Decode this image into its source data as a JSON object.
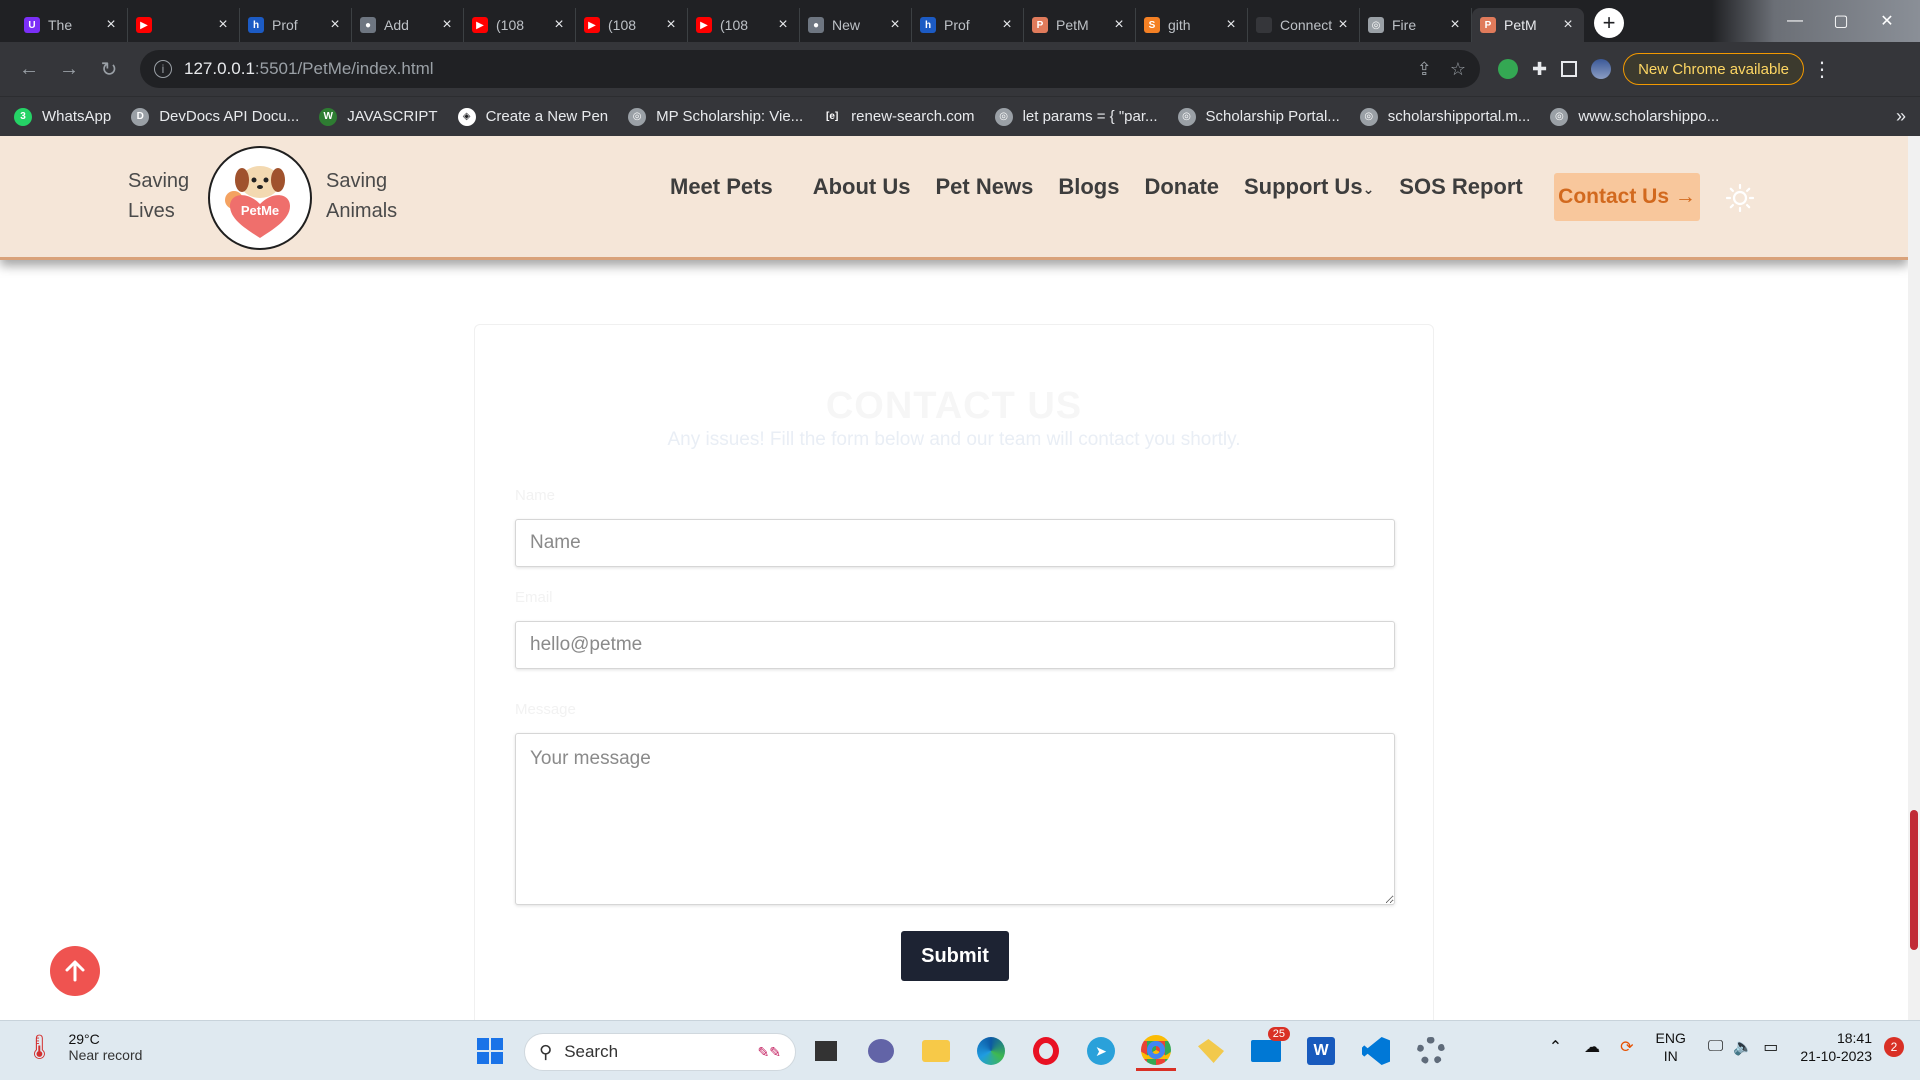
{
  "browser": {
    "tabs": [
      {
        "title": "The",
        "fav_color": "#7b2ff7",
        "fav_glyph": "U"
      },
      {
        "title": "",
        "fav_color": "#ff0000",
        "fav_glyph": "▶"
      },
      {
        "title": "Prof",
        "fav_color": "#1c5bc4",
        "fav_glyph": "h"
      },
      {
        "title": "Add",
        "fav_color": "#6e7681",
        "fav_glyph": "●"
      },
      {
        "title": "(108",
        "fav_color": "#ff0000",
        "fav_glyph": "▶"
      },
      {
        "title": "(108",
        "fav_color": "#ff0000",
        "fav_glyph": "▶"
      },
      {
        "title": "(108",
        "fav_color": "#ff0000",
        "fav_glyph": "▶"
      },
      {
        "title": "New",
        "fav_color": "#6e7681",
        "fav_glyph": "●"
      },
      {
        "title": "Prof",
        "fav_color": "#1c5bc4",
        "fav_glyph": "h"
      },
      {
        "title": "PetM",
        "fav_color": "#e07b5b",
        "fav_glyph": "P"
      },
      {
        "title": "gith",
        "fav_color": "#f48024",
        "fav_glyph": "S"
      },
      {
        "title": "Connect",
        "fav_color": "#35363a",
        "fav_glyph": ""
      },
      {
        "title": "Fire",
        "fav_color": "#9aa0a6",
        "fav_glyph": "◎"
      },
      {
        "title": "PetM",
        "fav_color": "#e07b5b",
        "fav_glyph": "P",
        "active": true
      }
    ],
    "url_host": "127.0.0.1",
    "url_path": ":5501/PetMe/index.html",
    "update_label": "New Chrome available",
    "bookmarks": [
      {
        "label": "WhatsApp",
        "color": "#25d366",
        "glyph": "3"
      },
      {
        "label": "DevDocs API Docu...",
        "color": "#9aa0a6",
        "glyph": "D"
      },
      {
        "label": "JAVASCRIPT",
        "color": "#2e7d32",
        "glyph": "W"
      },
      {
        "label": "Create a New Pen",
        "color": "#ffffff",
        "glyph": "◈"
      },
      {
        "label": "MP Scholarship: Vie...",
        "color": "#9aa0a6",
        "glyph": "◎"
      },
      {
        "label": "renew-search.com",
        "color": "#35363a",
        "glyph": "[e]"
      },
      {
        "label": "let params = { \"par...",
        "color": "#9aa0a6",
        "glyph": "◎"
      },
      {
        "label": "Scholarship Portal...",
        "color": "#9aa0a6",
        "glyph": "◎"
      },
      {
        "label": "scholarshipportal.m...",
        "color": "#9aa0a6",
        "glyph": "◎"
      },
      {
        "label": "www.scholarshippo...",
        "color": "#9aa0a6",
        "glyph": "◎"
      }
    ],
    "bookmarks_more": "»"
  },
  "site": {
    "tagline_left": [
      "Saving",
      "Lives"
    ],
    "tagline_right": [
      "Saving",
      "Animals"
    ],
    "logo_text": "PetMe",
    "nav": [
      "Meet Pets",
      "About Us",
      "Pet News",
      "Blogs",
      "Donate",
      "Support Us",
      "SOS Report"
    ],
    "contact_button": "Contact Us →",
    "accent": "#f8c79c",
    "nav_bg": "#f5e6d8"
  },
  "contact": {
    "title": "CONTACT US",
    "subtitle": "Any issues! Fill the form below and our team will contact you shortly.",
    "name_label": "Name",
    "name_placeholder": "Name",
    "email_label": "Email",
    "email_placeholder": "hello@petme",
    "message_label": "Message",
    "message_placeholder": "Your message",
    "submit_label": "Submit"
  },
  "taskbar": {
    "temp": "29°C",
    "weather_note": "Near record",
    "search_label": "Search",
    "mail_badge": "25",
    "lang_1": "ENG",
    "lang_2": "IN",
    "time": "18:41",
    "date": "21-10-2023",
    "notif_count": "2"
  }
}
